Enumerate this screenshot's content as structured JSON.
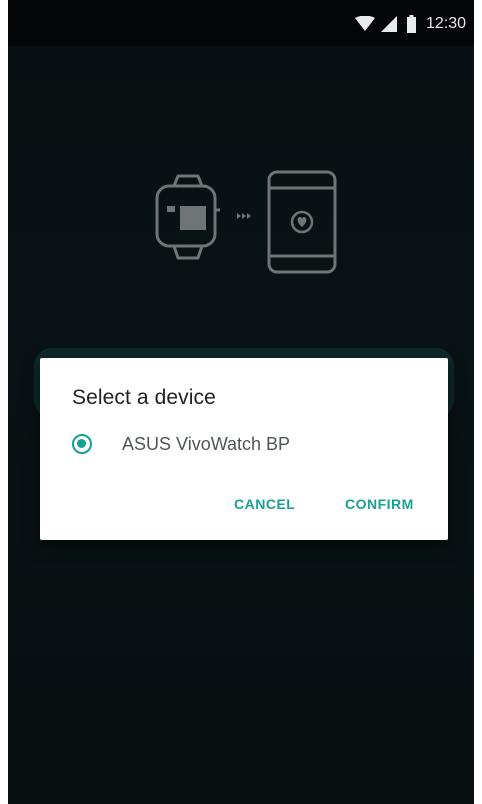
{
  "status_bar": {
    "time": "12:30",
    "icons": [
      "wifi-icon",
      "cellular-signal-icon",
      "battery-icon"
    ]
  },
  "illustration": {
    "icons": [
      "smartwatch-icon",
      "transfer-arrows-icon",
      "phone-heart-icon"
    ]
  },
  "dialog": {
    "title": "Select a device",
    "options": [
      {
        "label": "ASUS VivoWatch BP",
        "selected": true
      }
    ],
    "cancel_label": "CANCEL",
    "confirm_label": "CONFIRM"
  },
  "colors": {
    "accent": "#1a9f93",
    "background": "#0d1b1f",
    "status_bar": "#050607"
  }
}
